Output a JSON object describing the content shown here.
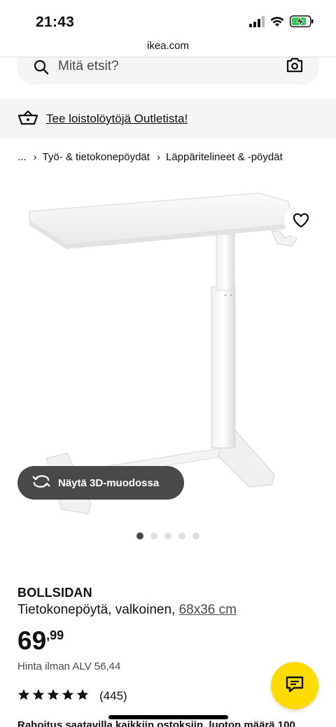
{
  "status_bar": {
    "time": "21:43"
  },
  "browser": {
    "url": "ikea.com"
  },
  "search": {
    "placeholder": "Mitä etsit?"
  },
  "promo": {
    "text": "Tee loistolöytöjä Outletista!"
  },
  "breadcrumb": {
    "ellipsis": "...",
    "items": [
      "Työ- & tietokonepöydät",
      "Läppäritelineet & -pöydät"
    ]
  },
  "gallery": {
    "view_3d_label": "Näytä 3D-muodossa",
    "total_images": 5,
    "active_index": 0
  },
  "product": {
    "name": "BOLLSIDAN",
    "description": "Tietokonepöytä, valkoinen,",
    "size": "68x36 cm",
    "price_int": "69",
    "price_dec": ",99",
    "vat_line": "Hinta ilman ALV 56,44",
    "rating_stars": 5,
    "rating_count": "(445)"
  },
  "finance": {
    "text": "Rahoitus saatavilla kaikkiin ostoksiin, luoton määrä 100"
  },
  "colors": {
    "accent_yellow": "#ffdb00",
    "dark_button": "#494949"
  }
}
